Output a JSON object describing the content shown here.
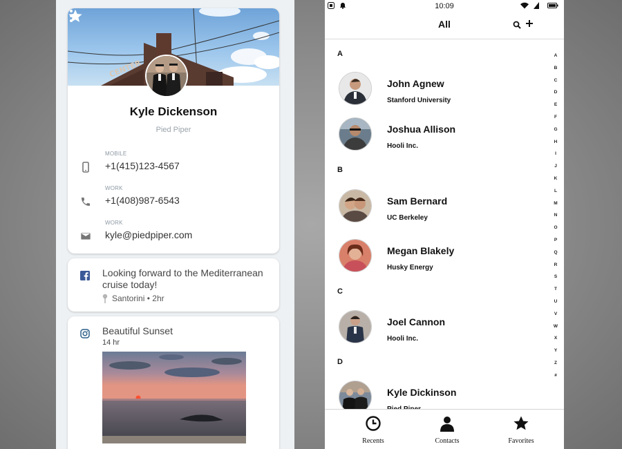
{
  "profile": {
    "name": "Kyle Dickenson",
    "company": "Pied Piper",
    "phones": [
      {
        "label": "MOBILE",
        "value": "+1(415)123-4567",
        "icon": "smartphone-icon"
      },
      {
        "label": "WORK",
        "value": "+1(408)987-6543",
        "icon": "phone-icon"
      }
    ],
    "email": {
      "label": "WORK",
      "value": "kyle@piedpiper.com",
      "icon": "mail-icon"
    },
    "post": {
      "text": "Looking forward to the Mediterranean cruise today!",
      "location": "Santorini",
      "time_sep": "•",
      "time": "2hr",
      "icon": "facebook-icon"
    },
    "instagram": {
      "title": "Beautiful Sunset",
      "time": "14 hr",
      "icon": "instagram-icon"
    }
  },
  "contacts_screen": {
    "status_time": "10:09",
    "title": "All",
    "sections": [
      {
        "letter": "A",
        "contacts": [
          {
            "name": "John Agnew",
            "org": "Stanford University"
          },
          {
            "name": "Joshua Allison",
            "org": "Hooli Inc."
          }
        ]
      },
      {
        "letter": "B",
        "contacts": [
          {
            "name": "Sam Bernard",
            "org": "UC Berkeley"
          },
          {
            "name": "Megan Blakely",
            "org": "Husky Energy"
          }
        ]
      },
      {
        "letter": "C",
        "contacts": [
          {
            "name": "Joel Cannon",
            "org": "Hooli Inc."
          }
        ]
      },
      {
        "letter": "D",
        "contacts": [
          {
            "name": "Kyle Dickinson",
            "org": "Pied Piper"
          }
        ]
      }
    ],
    "alphabet": [
      "A",
      "B",
      "C",
      "D",
      "E",
      "F",
      "G",
      "H",
      "I",
      "J",
      "K",
      "L",
      "M",
      "N",
      "O",
      "P",
      "Q",
      "R",
      "S",
      "T",
      "U",
      "V",
      "W",
      "X",
      "Y",
      "Z",
      "#"
    ],
    "nav": [
      {
        "label": "Recents",
        "icon": "clock-icon"
      },
      {
        "label": "Contacts",
        "icon": "person-icon"
      },
      {
        "label": "Favorites",
        "icon": "star-icon"
      }
    ]
  }
}
